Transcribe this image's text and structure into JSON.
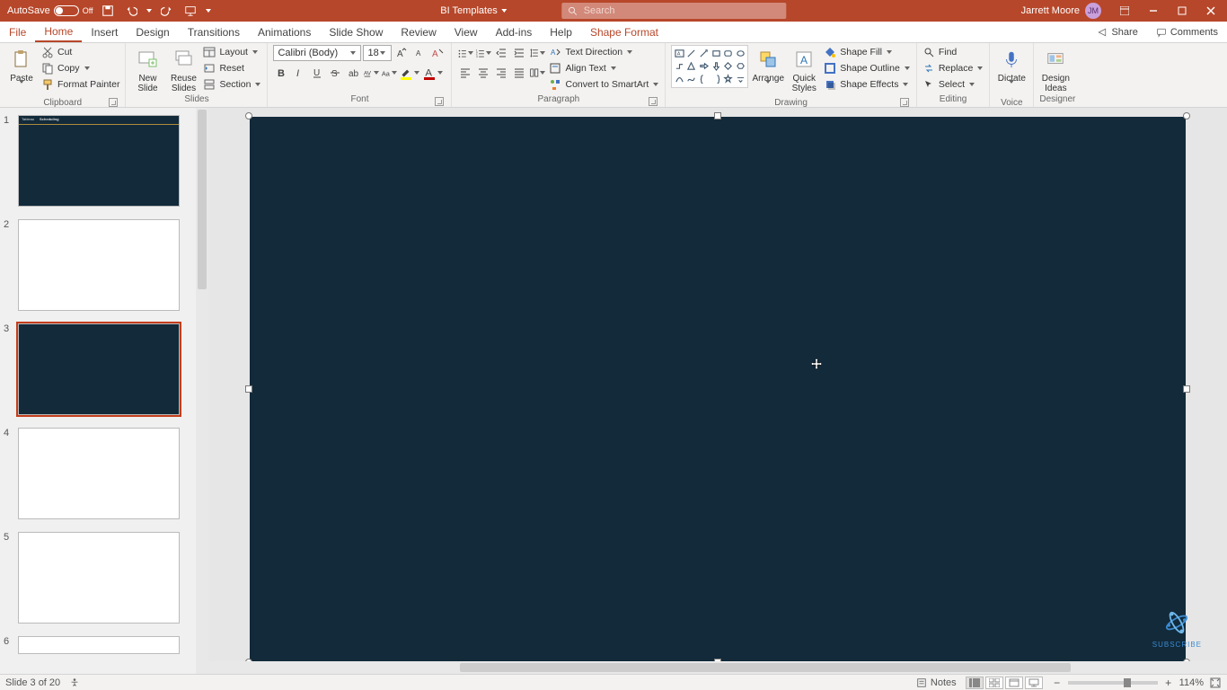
{
  "title_bar": {
    "autosave_label": "AutoSave",
    "autosave_state": "Off",
    "doc_title": "BI Templates",
    "search_placeholder": "Search",
    "user_name": "Jarrett Moore",
    "user_initials": "JM"
  },
  "tabs": {
    "file": "File",
    "home": "Home",
    "insert": "Insert",
    "design": "Design",
    "transitions": "Transitions",
    "animations": "Animations",
    "slideshow": "Slide Show",
    "review": "Review",
    "view": "View",
    "addins": "Add-ins",
    "help": "Help",
    "shape_format": "Shape Format",
    "share": "Share",
    "comments": "Comments"
  },
  "ribbon": {
    "clipboard": {
      "paste": "Paste",
      "cut": "Cut",
      "copy": "Copy",
      "format_painter": "Format Painter",
      "label": "Clipboard"
    },
    "slides": {
      "new_slide": "New\nSlide",
      "reuse_slides": "Reuse\nSlides",
      "layout": "Layout",
      "reset": "Reset",
      "section": "Section",
      "label": "Slides"
    },
    "font": {
      "name": "Calibri (Body)",
      "size": "18",
      "label": "Font"
    },
    "paragraph": {
      "text_direction": "Text Direction",
      "align_text": "Align Text",
      "convert_smartart": "Convert to SmartArt",
      "label": "Paragraph"
    },
    "drawing": {
      "arrange": "Arrange",
      "quick_styles": "Quick\nStyles",
      "shape_fill": "Shape Fill",
      "shape_outline": "Shape Outline",
      "shape_effects": "Shape Effects",
      "label": "Drawing"
    },
    "editing": {
      "find": "Find",
      "replace": "Replace",
      "select": "Select",
      "label": "Editing"
    },
    "voice": {
      "dictate": "Dictate",
      "label": "Voice"
    },
    "designer": {
      "design_ideas": "Design\nIdeas",
      "label": "Designer"
    }
  },
  "thumbnails": {
    "slide1_labels": {
      "a": "Tableau",
      "b": "Scheduling"
    },
    "numbers": [
      "1",
      "2",
      "3",
      "4",
      "5",
      "6"
    ]
  },
  "status": {
    "slide_info": "Slide 3 of 20",
    "notes": "Notes",
    "zoom_pct": "114%"
  },
  "misc": {
    "subscribe": "SUBSCRIBE"
  }
}
